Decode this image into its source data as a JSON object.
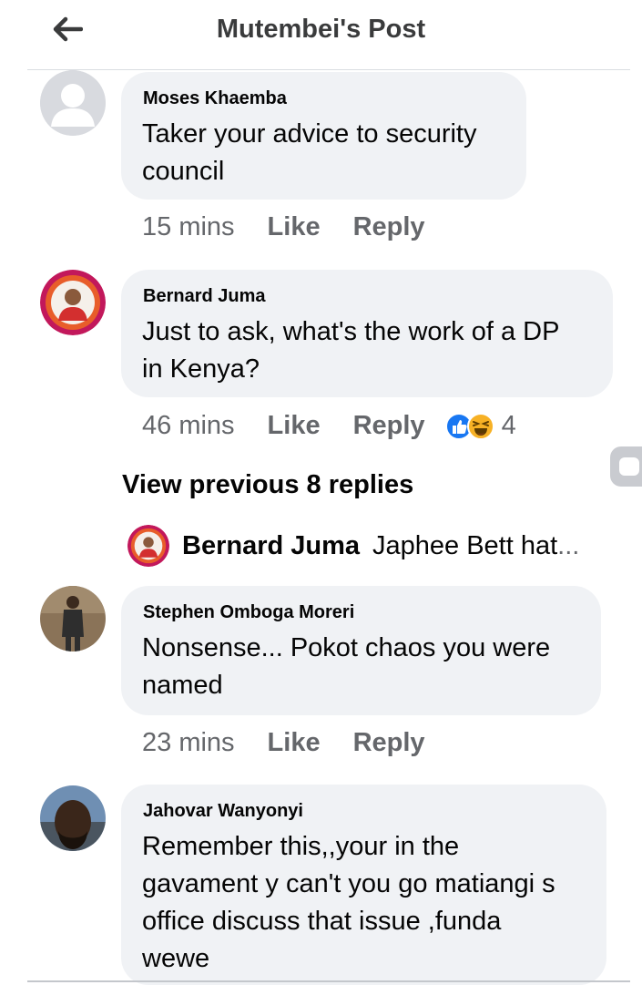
{
  "header": {
    "title": "Mutembei's Post",
    "back_icon": "arrow-left-icon"
  },
  "comments": [
    {
      "author": "Moses Khaemba",
      "text": "Taker your advice to security\ncouncil",
      "time": "15 mins",
      "like": "Like",
      "reply": "Reply",
      "avatar_icon": "default-avatar-icon"
    },
    {
      "author": "Bernard Juma",
      "text": "Just to ask, what's the work of a DP\nin Kenya?",
      "time": "46 mins",
      "like": "Like",
      "reply": "Reply",
      "reactions": {
        "icons": [
          "like-reaction-icon",
          "haha-reaction-icon"
        ],
        "count": "4"
      }
    },
    {
      "author": "Stephen Omboga Moreri",
      "text": "Nonsense... Pokot chaos you were\nnamed",
      "time": "23 mins",
      "like": "Like",
      "reply": "Reply"
    },
    {
      "author": "Jahovar Wanyonyi",
      "text": "Remember this,,your in the\ngavament y can't you go matiangi s\noffice discuss that issue ,funda\nwewe"
    }
  ],
  "view_previous": "View previous 8 replies",
  "reply_preview": {
    "author": "Bernard Juma",
    "text": "Japhee Bett hat",
    "ellipsis": "..."
  },
  "colors": {
    "bubble": "#f0f2f5",
    "meta_text": "#65676b",
    "like_blue": "#1877f2",
    "haha_yellow": "#f7b125"
  }
}
